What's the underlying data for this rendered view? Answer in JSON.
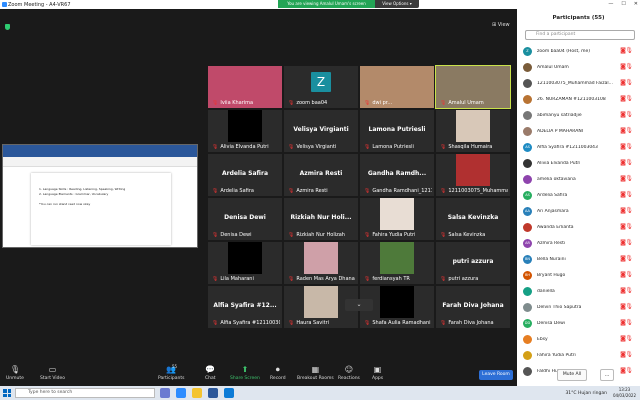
{
  "window": {
    "title": "Zoom Meeting - A4-VR67"
  },
  "banner": {
    "text": "You are viewing Amalul Umam's screen",
    "view_options": "View Options ▾"
  },
  "window_controls": {
    "minimize": "—",
    "maximize": "☐",
    "close": "✕"
  },
  "view_button": "⊞ View",
  "shared_doc": {
    "lines": [
      "1.   Language Skills     :  Reading, Listening, Speaking, Writing",
      "2.   Language Elements   :  Grammar, Vocabulary",
      "",
      "*You can run stand read now okay"
    ]
  },
  "tiles": [
    {
      "name": "Iviia Kharima",
      "big": ""
    },
    {
      "name": "zoom baa04",
      "big": "",
      "avatar": "Z"
    },
    {
      "name": "dwi pr...",
      "big": ""
    },
    {
      "name": "Amalul Umam",
      "big": ""
    },
    {
      "name": "Alivia Elvanda Putri",
      "big": ""
    },
    {
      "name": "Velisya Virgianti",
      "big": "Velisya Virgianti"
    },
    {
      "name": "Lamona Putriesli",
      "big": "Lamona Putriesli"
    },
    {
      "name": "Shasqila Humaira",
      "big": ""
    },
    {
      "name": "Ardelia Safira",
      "big": "Ardelia Safira"
    },
    {
      "name": "Azmira Resti",
      "big": "Azmira Resti"
    },
    {
      "name": "Gandha Ramdhani_12110...",
      "big": "Gandha Ramdh..."
    },
    {
      "name": "1211003075_Muhammad F...",
      "big": ""
    },
    {
      "name": "Denisa Dewi",
      "big": "Denisa Dewi"
    },
    {
      "name": "Rizkiah Nur Holizah",
      "big": "Rizkiah Nur Holi..."
    },
    {
      "name": "Fahira Yudia Putri",
      "big": ""
    },
    {
      "name": "Salsa Kevinzka",
      "big": "Salsa Kevinzka"
    },
    {
      "name": "Lila Maharani",
      "big": ""
    },
    {
      "name": "Raden Mas Arya Dhana Pr...",
      "big": ""
    },
    {
      "name": "ferdiansyah TR",
      "big": ""
    },
    {
      "name": "putri azzura",
      "big": "putri azzura"
    },
    {
      "name": "Alfia Syafira #1211003043",
      "big": "Alfia Syafira #12..."
    },
    {
      "name": "Haura Savitri",
      "big": ""
    },
    {
      "name": "Shafa Aulia Ramadhani",
      "big": ""
    },
    {
      "name": "Farah Diva Johana",
      "big": "Farah Diva Johana"
    }
  ],
  "chevron": "⌄",
  "toolbar": {
    "unmute": "Unmute",
    "start_video": "Start Video",
    "participants": "Participants",
    "participants_count": "55",
    "chat": "Chat",
    "share_screen": "Share Screen",
    "record": "Record",
    "breakout": "Breakout Rooms",
    "reactions": "Reactions",
    "apps": "Apps",
    "leave": "Leave Room"
  },
  "panel": {
    "title": "Participants (55)",
    "search_placeholder": "Find a participant",
    "participants": [
      {
        "name": "zoom baa04 (Host, me)",
        "initials": "Z",
        "color": "#1a8f9f"
      },
      {
        "name": "Amalul Umam",
        "initials": "",
        "color": "#7a5c3a"
      },
      {
        "name": "1211003075_Muhammad Faizal...",
        "initials": "",
        "color": "#555555"
      },
      {
        "name": "26. NURZAMAN #1211003108",
        "initials": "",
        "color": "#b87333"
      },
      {
        "name": "abimanyu satriadjie",
        "initials": "",
        "color": "#777777"
      },
      {
        "name": "ADELIA P MAHARANI",
        "initials": "",
        "color": "#9a7b6a"
      },
      {
        "name": "Alfia Syafira #1211003043",
        "initials": "AS",
        "color": "#1e8bc3"
      },
      {
        "name": "Alivia Elvanda Putri",
        "initials": "",
        "color": "#333333"
      },
      {
        "name": "amelia oktaviana",
        "initials": "",
        "color": "#8e44ad"
      },
      {
        "name": "Ardelia Safira",
        "initials": "AS",
        "color": "#27ae60"
      },
      {
        "name": "Ari Anjasmara",
        "initials": "AA",
        "color": "#2980b9"
      },
      {
        "name": "Awanda Erlianta",
        "initials": "",
        "color": "#c0392b"
      },
      {
        "name": "Azmira Resti",
        "initials": "AR",
        "color": "#8e44ad"
      },
      {
        "name": "Bella Nuraini",
        "initials": "BN",
        "color": "#2980b9"
      },
      {
        "name": "Bryant Hugo",
        "initials": "BH",
        "color": "#d35400"
      },
      {
        "name": "daniella",
        "initials": "",
        "color": "#16a085"
      },
      {
        "name": "Delvin Thio Saputra",
        "initials": "",
        "color": "#7f8c8d"
      },
      {
        "name": "Denisa Dewi",
        "initials": "DD",
        "color": "#27ae60"
      },
      {
        "name": "Ebsy",
        "initials": "",
        "color": "#e67e22"
      },
      {
        "name": "Fahira Yudia Putri",
        "initials": "",
        "color": "#d4a017"
      },
      {
        "name": "Faldhi Hutama Hakim",
        "initials": "",
        "color": "#555555"
      }
    ],
    "mute_all": "Mute All",
    "more": "..."
  },
  "taskbar": {
    "search_placeholder": "Type here to search",
    "weather": "31°C  Hujan ringan",
    "time": "13:23",
    "date": "04/03/2022"
  }
}
